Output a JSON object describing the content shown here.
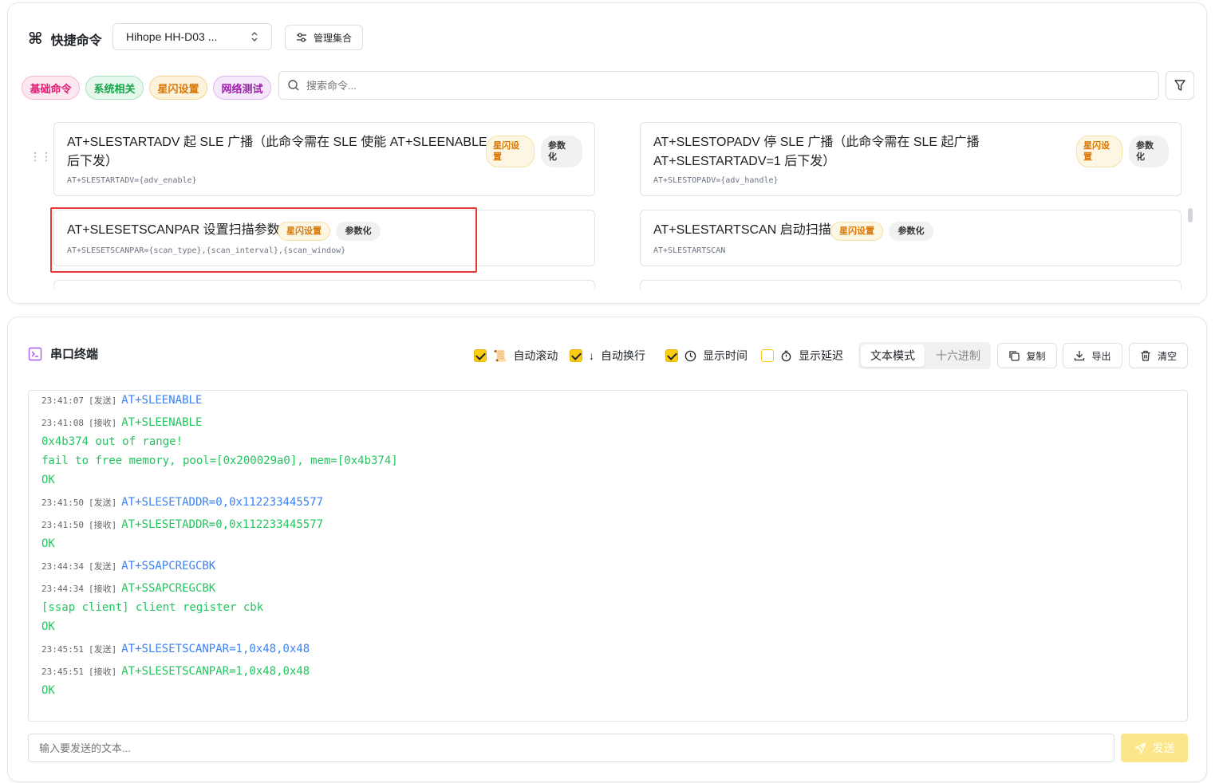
{
  "header": {
    "title": "快捷命令",
    "device": "Hihope HH-D03 ...",
    "manage_label": "管理集合"
  },
  "tags": [
    {
      "label": "基础命令",
      "color": "#e11d74",
      "bg": "#fde7f0",
      "border": "#f7b6cf"
    },
    {
      "label": "系统相关",
      "color": "#16a34a",
      "bg": "#e6f7ec",
      "border": "#a7e3bd"
    },
    {
      "label": "星闪设置",
      "color": "#d97706",
      "bg": "#fdf3dc",
      "border": "#f3d48f"
    },
    {
      "label": "网络测试",
      "color": "#a21caf",
      "bg": "#f5e8fb",
      "border": "#ddb4ef"
    }
  ],
  "search": {
    "placeholder": "搜索命令..."
  },
  "commands": [
    {
      "title_l1": "AT+SLESTARTADV 起 SLE 广播（此命令需在 SLE 使能 AT+SLEENABLE",
      "title_l2": "后下发）",
      "code": "AT+SLESTARTADV={adv_enable}",
      "tag": "星闪设\n置",
      "param": "参数\n化"
    },
    {
      "title_l1": "AT+SLESTOPADV 停 SLE 广播（此命令需在 SLE 起广播",
      "title_l2": "AT+SLESTARTADV=1 后下发）",
      "code": "AT+SLESTOPADV={adv_handle}",
      "tag": "星闪设\n置",
      "param": "参数\n化"
    },
    {
      "title": "AT+SLESETSCANPAR 设置扫描参数",
      "code": "AT+SLESETSCANPAR={scan_type},{scan_interval},{scan_window}",
      "tag": "星闪设置",
      "param": "参数化"
    },
    {
      "title": "AT+SLESTARTSCAN 启动扫描",
      "code": "AT+SLESTARTSCAN",
      "tag": "星闪设置",
      "param": "参数化"
    }
  ],
  "terminal": {
    "title": "串口终端",
    "options": {
      "auto_scroll": "自动滚动",
      "auto_wrap": "自动换行",
      "show_time": "显示时间",
      "show_delay": "显示延迟"
    },
    "mode_text": "文本模式",
    "mode_hex": "十六进制",
    "copy": "复制",
    "export": "导出",
    "clear": "清空",
    "lines": [
      {
        "ts": "23:41:07",
        "dir": "[发送]",
        "text": "AT+SLEENABLE",
        "kind": "send"
      },
      {
        "ts": "23:41:08",
        "dir": "[接收]",
        "text": "AT+SLEENABLE",
        "kind": "recv"
      },
      {
        "ts": "",
        "dir": "",
        "text": "0x4b374 out of range!",
        "kind": "recv"
      },
      {
        "ts": "",
        "dir": "",
        "text": "fail to free memory, pool=[0x200029a0], mem=[0x4b374]",
        "kind": "recv"
      },
      {
        "ts": "",
        "dir": "",
        "text": "OK",
        "kind": "recv"
      },
      {
        "ts": "23:41:50",
        "dir": "[发送]",
        "text": "AT+SLESETADDR=0,0x112233445577",
        "kind": "send"
      },
      {
        "ts": "23:41:50",
        "dir": "[接收]",
        "text": "AT+SLESETADDR=0,0x112233445577",
        "kind": "recv"
      },
      {
        "ts": "",
        "dir": "",
        "text": "OK",
        "kind": "recv"
      },
      {
        "ts": "23:44:34",
        "dir": "[发送]",
        "text": "AT+SSAPCREGCBK",
        "kind": "send"
      },
      {
        "ts": "23:44:34",
        "dir": "[接收]",
        "text": "AT+SSAPCREGCBK",
        "kind": "recv"
      },
      {
        "ts": "",
        "dir": "",
        "text": "[ssap client] client register cbk",
        "kind": "recv"
      },
      {
        "ts": "",
        "dir": "",
        "text": "OK",
        "kind": "recv"
      },
      {
        "ts": "23:45:51",
        "dir": "[发送]",
        "text": "AT+SLESETSCANPAR=1,0x48,0x48",
        "kind": "send"
      },
      {
        "ts": "23:45:51",
        "dir": "[接收]",
        "text": "AT+SLESETSCANPAR=1,0x48,0x48",
        "kind": "recv"
      },
      {
        "ts": "",
        "dir": "",
        "text": "OK",
        "kind": "recv"
      }
    ],
    "input_placeholder": "输入要发送的文本...",
    "send_label": "发送"
  }
}
